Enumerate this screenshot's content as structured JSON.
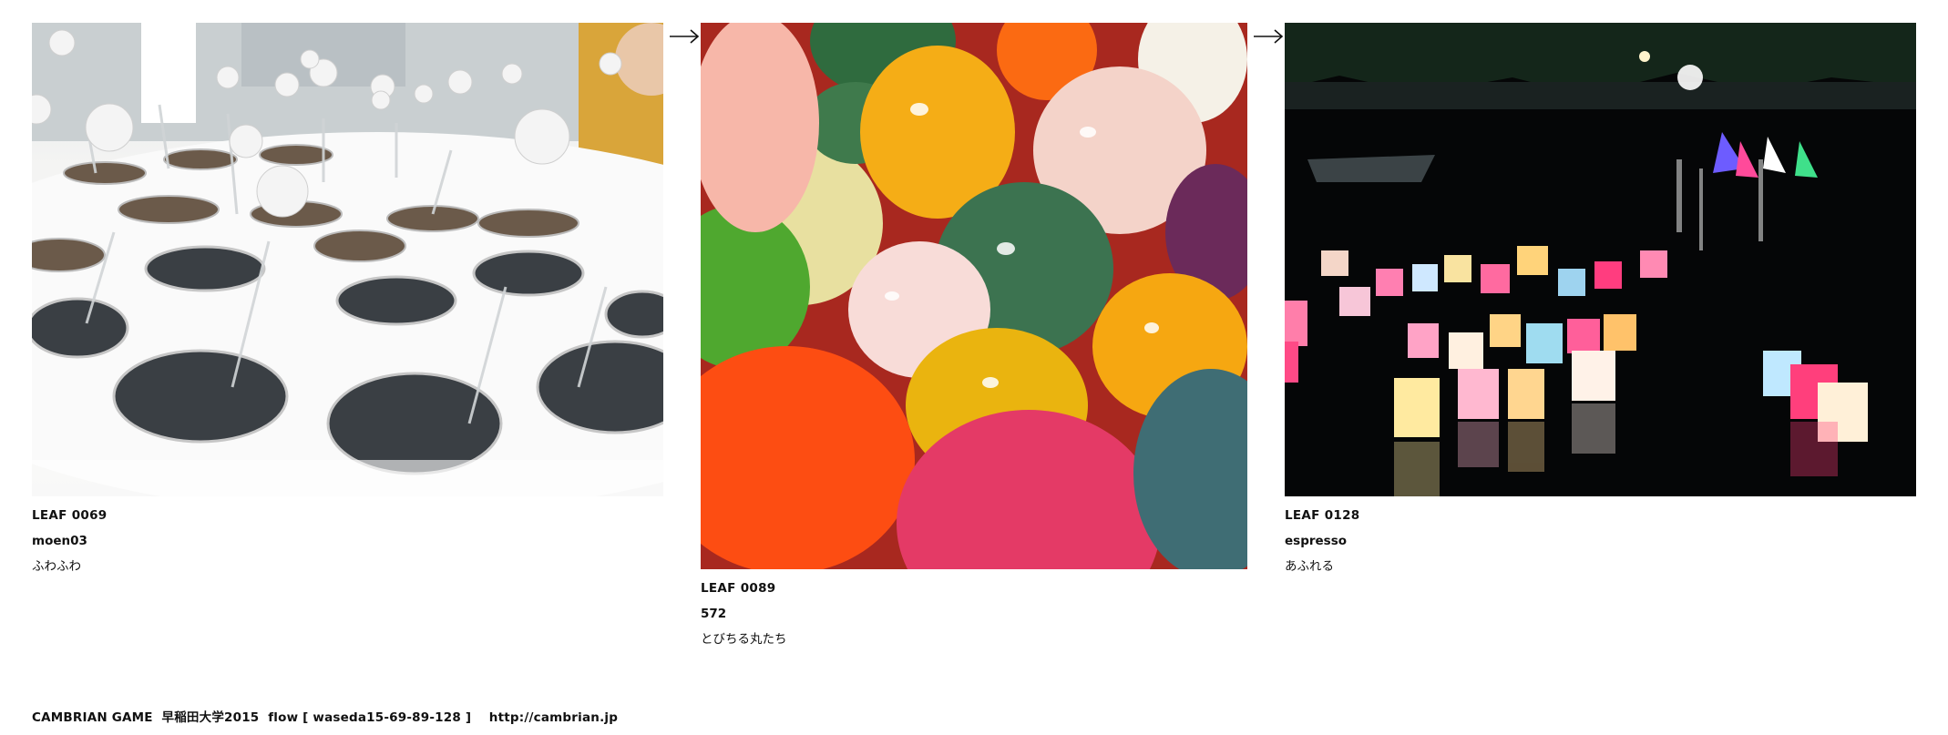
{
  "leaves": [
    {
      "code": "LEAF 0069",
      "user": "moen03",
      "title": "ふわふわ"
    },
    {
      "code": "LEAF 0089",
      "user": "572",
      "title": "とびちる丸たち"
    },
    {
      "code": "LEAF 0128",
      "user": "espresso",
      "title": "あふれる"
    }
  ],
  "arrows": [
    "→",
    "→"
  ],
  "footer": {
    "text": "CAMBRIAN GAME  早稲田大学2015  flow [ waseda15-69-89-128 ]    http://cambrian.jp"
  }
}
